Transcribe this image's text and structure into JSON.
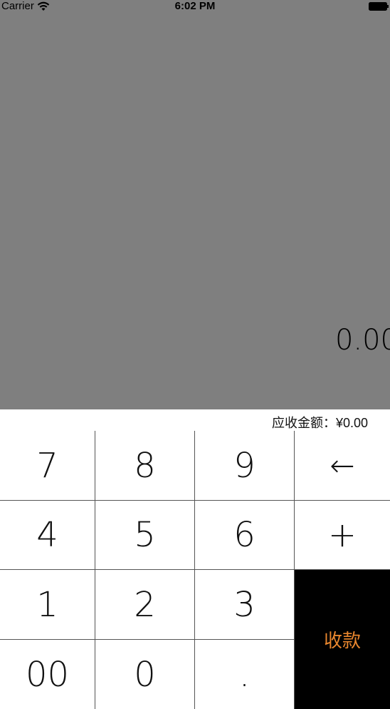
{
  "status_bar": {
    "carrier": "Carrier",
    "time": "6:02 PM",
    "icons": [
      "wifi-icon",
      "battery-icon"
    ]
  },
  "display": {
    "value": "0.00"
  },
  "receivable": {
    "text": "应收金额：¥0.00"
  },
  "keypad": {
    "keys": [
      {
        "label": "7"
      },
      {
        "label": "8"
      },
      {
        "label": "9"
      },
      {
        "label": "←"
      },
      {
        "label": "4"
      },
      {
        "label": "5"
      },
      {
        "label": "6"
      },
      {
        "label": "+"
      },
      {
        "label": "1"
      },
      {
        "label": "2"
      },
      {
        "label": "3"
      },
      {
        "label": "00"
      },
      {
        "label": "0"
      },
      {
        "label": "."
      }
    ],
    "pay_label": "收款"
  },
  "colors": {
    "background_gray": "#7f7f7f",
    "pay_button_bg": "#000000",
    "pay_button_text": "#e8862e"
  }
}
